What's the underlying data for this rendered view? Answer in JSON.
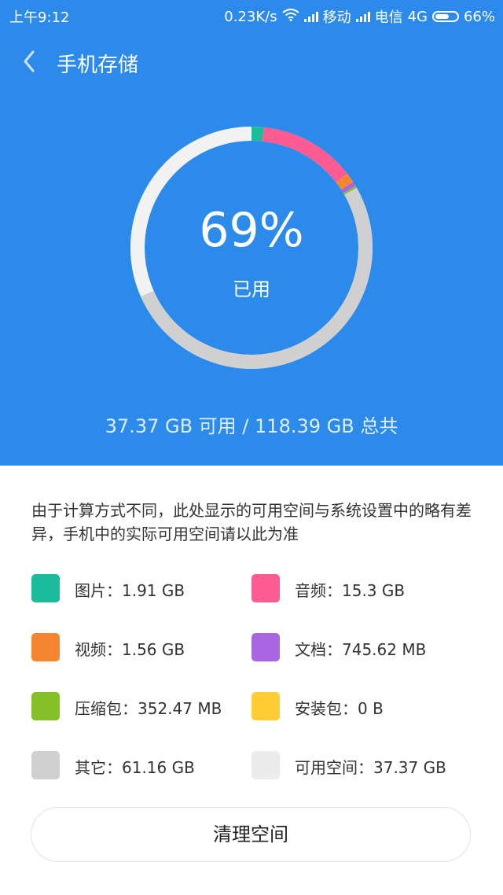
{
  "status_bar": {
    "time": "上午9:12",
    "speed": "0.23K/s",
    "carrier1": "移动",
    "carrier2": "电信",
    "network": "4G",
    "battery": "66%",
    "battery_level": 0.66,
    "icons": [
      "wifi-icon",
      "signal-icon",
      "battery-icon"
    ]
  },
  "header": {
    "title": "手机存储",
    "back_icon": "chevron-left-icon"
  },
  "summary": {
    "percent": "69%",
    "used_label": "已用",
    "capacity": "37.37 GB 可用 / 118.39 GB 总共"
  },
  "ring_data": {
    "total_gb": 118.39,
    "segments": [
      {
        "name": "图片",
        "gb": 1.91,
        "color": "#1bbc9b"
      },
      {
        "name": "音频",
        "gb": 15.3,
        "color": "#fd5b91"
      },
      {
        "name": "视频",
        "gb": 1.56,
        "color": "#f5852f"
      },
      {
        "name": "文档",
        "gb": 0.7282,
        "color": "#a866e1"
      },
      {
        "name": "压缩包",
        "gb": 0.3442,
        "color": "#84c026"
      },
      {
        "name": "安装包",
        "gb": 0,
        "color": "#ffcc33"
      },
      {
        "name": "其它",
        "gb": 61.16,
        "color": "#d0d0d0"
      },
      {
        "name": "可用空间",
        "gb": 37.37,
        "color": "#f2f2f2"
      }
    ]
  },
  "note": "由于计算方式不同，此处显示的可用空间与系统设置中的略有差异，手机中的实际可用空间请以此为准",
  "legend": [
    {
      "label": "图片：1.91 GB",
      "color": "#1bbc9b"
    },
    {
      "label": "音频：15.3 GB",
      "color": "#fd5b91"
    },
    {
      "label": "视频：1.56 GB",
      "color": "#f5852f"
    },
    {
      "label": "文档：745.62 MB",
      "color": "#a866e1"
    },
    {
      "label": "压缩包：352.47 MB",
      "color": "#84c026"
    },
    {
      "label": "安装包：0 B",
      "color": "#ffcc33"
    },
    {
      "label": "其它：61.16 GB",
      "color": "#d0d0d0"
    },
    {
      "label": "可用空间：37.37 GB",
      "color": "#ececec"
    }
  ],
  "button": {
    "label": "清理空间"
  },
  "colors": {
    "header_bg": "#2c8bea",
    "ring_track": "#f2f2f2"
  }
}
